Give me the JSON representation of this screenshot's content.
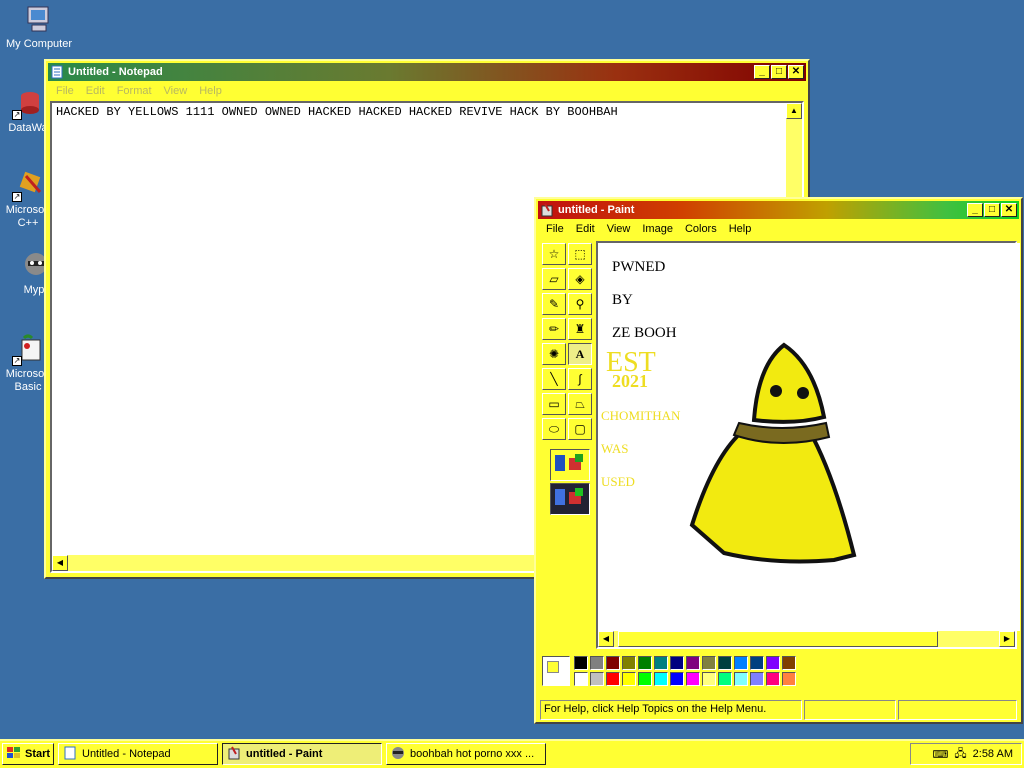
{
  "desktop": {
    "icons": [
      {
        "label": "My Computer"
      },
      {
        "label": "DataWa"
      },
      {
        "label": "Microsoft"
      },
      {
        "label": "C++"
      },
      {
        "label": "Myp"
      },
      {
        "label": "Microsoft"
      },
      {
        "label": "Basic"
      }
    ]
  },
  "notepad": {
    "title": "Untitled - Notepad",
    "menu": [
      "File",
      "Edit",
      "Format",
      "View",
      "Help"
    ],
    "content": "HACKED BY YELLOWS 1111 OWNED OWNED HACKED HACKED HACKED REVIVE HACK BY BOOHBAH"
  },
  "paint": {
    "title": "untitled - Paint",
    "menu": [
      "File",
      "Edit",
      "View",
      "Image",
      "Colors",
      "Help"
    ],
    "canvas_text": {
      "line1": "PWNED",
      "line2": "BY",
      "line3": "ZE BOOH",
      "est": "EST",
      "year": "2021",
      "chem": "CHOMITHAN",
      "was": "WAS",
      "used": "USED"
    },
    "status": "For Help, click Help Topics on the Help Menu.",
    "palette_top": [
      "#000000",
      "#808080",
      "#800000",
      "#808000",
      "#008000",
      "#008080",
      "#000080",
      "#800080",
      "#808040",
      "#004040",
      "#0080ff",
      "#004080",
      "#8000ff",
      "#804000"
    ],
    "palette_bottom": [
      "#ffffff",
      "#c0c0c0",
      "#ff0000",
      "#ffff00",
      "#00ff00",
      "#00ffff",
      "#0000ff",
      "#ff00ff",
      "#ffff80",
      "#00ff80",
      "#80ffff",
      "#8080ff",
      "#ff0080",
      "#ff8040"
    ],
    "colors": {
      "character": "#f2ea10",
      "scarf": "#7a6a20"
    }
  },
  "taskbar": {
    "start": "Start",
    "tasks": [
      {
        "label": "Untitled - Notepad"
      },
      {
        "label": "untitled - Paint"
      },
      {
        "label": "boohbah hot porno xxx ..."
      }
    ],
    "clock": "2:58 AM"
  },
  "theme": {
    "window": "#ffff33",
    "desktop": "#3a6ea5"
  }
}
